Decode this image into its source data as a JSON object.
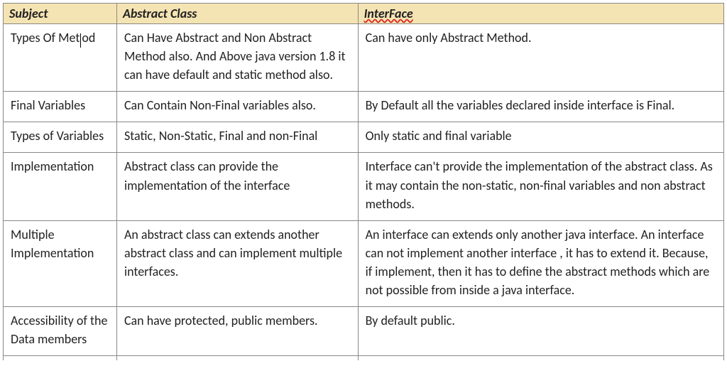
{
  "headers": {
    "subject": "Subject",
    "abstract": "Abstract Class",
    "interface": "InterFace"
  },
  "rows": [
    {
      "subject_pre": "Types Of Met",
      "subject_post": "od",
      "has_cursor": true,
      "abstract": "Can Have Abstract and Non Abstract Method also. And Above java version 1.8 it can have default and static method also.",
      "interface": "Can have only Abstract Method."
    },
    {
      "subject": "Final Variables",
      "abstract": "Can Contain Non-Final variables also.",
      "interface": "By Default all the variables declared inside interface is Final."
    },
    {
      "subject": "Types of Variables",
      "abstract": "Static, Non-Static, Final and non-Final",
      "interface": "Only static and final variable"
    },
    {
      "subject": "Implementation",
      "abstract": "Abstract class can provide the implementation of the interface",
      "interface": "Interface can't provide the implementation of the abstract class. As it may contain the non-static, non-final    variables and non abstract methods."
    },
    {
      "subject": "Multiple Implementation",
      "abstract": "An abstract class can extends another abstract class and can implement multiple interfaces.",
      "interface": "An interface can extends only another java interface. An interface can not implement another interface , it has to extend it. Because, if implement, then it has to define the abstract methods which are not possible from inside a java interface."
    },
    {
      "subject": "Accessibility of the Data members",
      "abstract": "Can have protected, public members.",
      "interface": "By default public."
    }
  ]
}
